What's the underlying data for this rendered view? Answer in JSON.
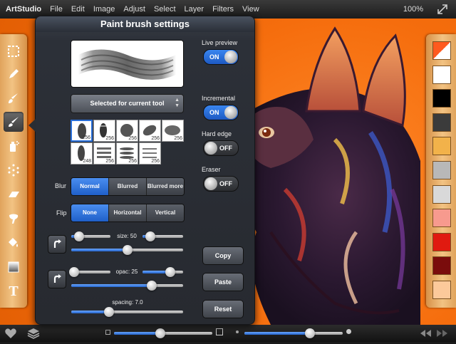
{
  "menubar": {
    "app_name": "ArtStudio",
    "menus": [
      "File",
      "Edit",
      "Image",
      "Adjust",
      "Select",
      "Layer",
      "Filters",
      "View"
    ],
    "zoom": "100%"
  },
  "toolbar": {
    "tools": [
      "selection-marquee",
      "pencil",
      "brush",
      "paint-brush",
      "spray-can",
      "scatter",
      "eraser",
      "smudge",
      "fill-bucket",
      "gradient",
      "text"
    ],
    "selected": "paint-brush",
    "text_tool_glyph": "T"
  },
  "palette": {
    "colors": [
      "#ff5a1e",
      "#ffffff",
      "#000000",
      "#3b3b3b",
      "#f2b24a",
      "#b8b8b8",
      "#d9d9d9",
      "#f79a8e",
      "#e01a10",
      "#7a0c0c",
      "#fcc99a"
    ]
  },
  "panel": {
    "title": "Paint brush settings",
    "preset_button": "Selected for current tool",
    "brushes": [
      {
        "size": "256",
        "selected": true
      },
      {
        "size": "256",
        "selected": false
      },
      {
        "size": "256",
        "selected": false
      },
      {
        "size": "256",
        "selected": false
      },
      {
        "size": "256",
        "selected": false
      },
      {
        "size": "248",
        "selected": false
      },
      {
        "size": "256",
        "selected": false
      },
      {
        "size": "256",
        "selected": false
      },
      {
        "size": "256",
        "selected": false
      }
    ],
    "blur": {
      "label": "Blur",
      "options": [
        "Normal",
        "Blurred",
        "Blurred more"
      ],
      "selected": 0
    },
    "flip": {
      "label": "Flip",
      "options": [
        "None",
        "Horizontal",
        "Vertical"
      ],
      "selected": 0
    },
    "size": {
      "label": "size: 50",
      "value": 0.5,
      "min_value": 0.2,
      "max_value": 0.2
    },
    "opacity": {
      "label": "opac: 25",
      "value": 0.72,
      "min_value": 0.08,
      "max_value": 0.68
    },
    "spacing": {
      "label": "spacing: 7.0",
      "value": 0.34
    },
    "toggles": {
      "live_preview": {
        "label": "Live preview",
        "state": "ON"
      },
      "incremental": {
        "label": "Incremental",
        "state": "ON"
      },
      "hard_edge": {
        "label": "Hard edge",
        "state": "OFF"
      },
      "eraser": {
        "label": "Eraser",
        "state": "OFF"
      }
    },
    "actions": {
      "copy": "Copy",
      "paste": "Paste",
      "reset": "Reset"
    }
  },
  "bottombar": {
    "slider_left": 0.47,
    "slider_right": 0.67
  }
}
